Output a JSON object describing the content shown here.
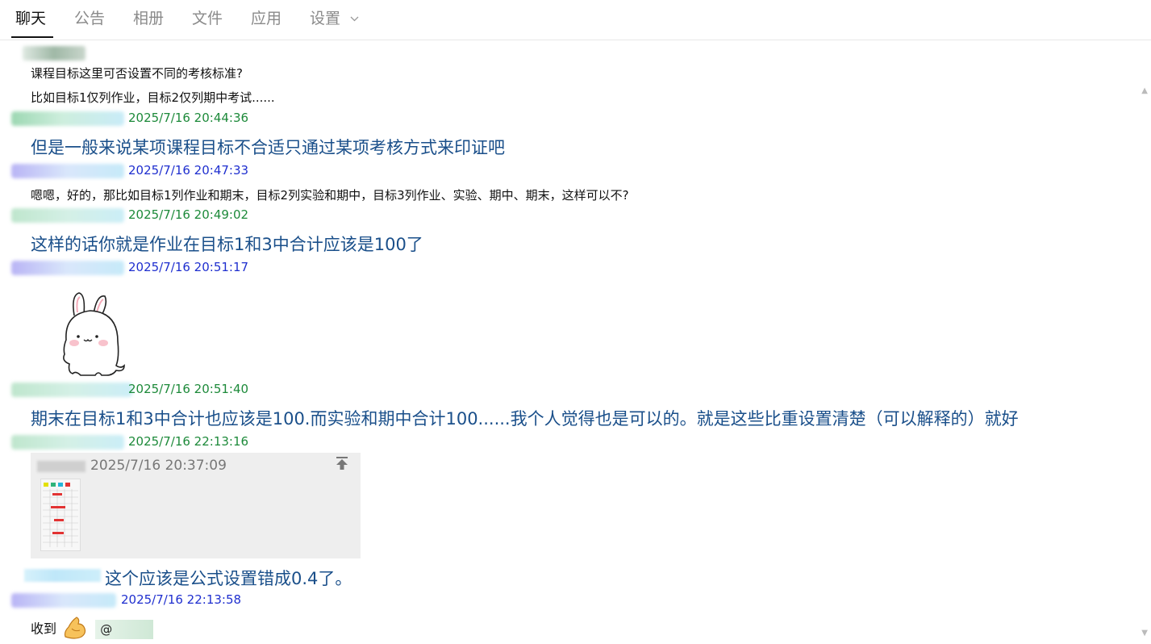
{
  "tabs": [
    {
      "label": "聊天"
    },
    {
      "label": "公告"
    },
    {
      "label": "相册"
    },
    {
      "label": "文件"
    },
    {
      "label": "应用"
    },
    {
      "label": "设置"
    }
  ],
  "messages": {
    "m1_line1": "课程目标这里可否设置不同的考核标准?",
    "m1_line2": "比如目标1仅列作业，目标2仅列期中考试......",
    "m2_ts": "2025/7/16 20:44:36",
    "m2_text": "但是一般来说某项课程目标不合适只通过某项考核方式来印证吧",
    "m3_ts": "2025/7/16 20:47:33",
    "m3_text": "嗯嗯，好的，那比如目标1列作业和期末，目标2列实验和期中，目标3列作业、实验、期中、期末，这样可以不?",
    "m4_ts": "2025/7/16 20:49:02",
    "m4_text": "这样的话你就是作业在目标1和3中合计应该是100了",
    "m5_ts": "2025/7/16 20:51:17",
    "m6_ts": "2025/7/16 20:51:40",
    "m6_text": "期末在目标1和3中合计也应该是100.而实验和期中合计100......我个人觉得也是可以的。就是这些比重设置清楚（可以解释的）就好",
    "m7_ts": "2025/7/16 22:13:16",
    "m7_quote_ts": "2025/7/16 20:37:09",
    "m7_text": "这个应该是公式设置错成0.4了。",
    "m8_ts": "2025/7/16 22:13:58",
    "m8_text": "收到",
    "m8_at": "@"
  },
  "colors": {
    "timestamp_green": "#1d8a3a",
    "timestamp_blue": "#1f2fcf",
    "message_blue": "#1a4f8a"
  }
}
